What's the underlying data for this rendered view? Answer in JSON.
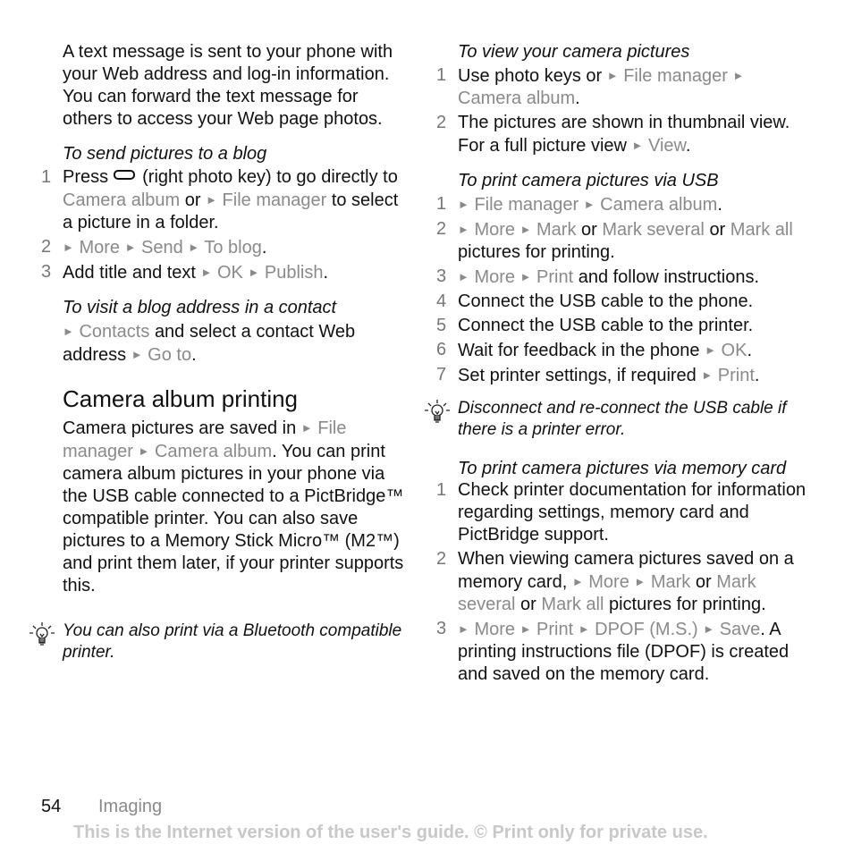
{
  "left": {
    "intro": "A text message is sent to your phone with your Web address and log-in information. You can forward the text message for others to access your Web page photos.",
    "send_blog": {
      "heading": "To send pictures to a blog",
      "s1_a": "Press",
      "s1_b": "(right photo key) to go directly to",
      "s1_g1": "Camera album",
      "s1_c": "or",
      "s1_g2": "File manager",
      "s1_d": "to select a picture in a folder.",
      "s2": [
        "More",
        "Send",
        "To blog"
      ],
      "s3_text": "Add title and text",
      "s3": [
        "OK",
        "Publish"
      ]
    },
    "visit_blog": {
      "heading": "To visit a blog address in a contact",
      "g1": "Contacts",
      "t1": "and select a contact Web address",
      "g2": "Go to"
    },
    "section": {
      "title": "Camera album printing",
      "t1": "Camera pictures are saved in",
      "g1": "File manager",
      "g2": "Camera album",
      "t2": ". You can print camera album pictures in your phone via the USB cable connected to a PictBridge™ compatible printer. You can also save pictures to a Memory Stick Micro™ (M2™) and print them later, if your printer supports this."
    },
    "tip": "You can also print via a Bluetooth compatible printer."
  },
  "right": {
    "view": {
      "heading": "To view your camera pictures",
      "s1_text": "Use photo keys or",
      "s1": [
        "File manager",
        "Camera album"
      ],
      "s2_text": "The pictures are shown in thumbnail view. For a full picture view",
      "s2_g": "View"
    },
    "usb": {
      "heading": "To print camera pictures via USB",
      "s1": [
        "File manager",
        "Camera album"
      ],
      "s2_g1": "More",
      "s2_g2": "Mark",
      "s2_or": "or",
      "s2_g3": "Mark several",
      "s2_g4": "Mark all",
      "s2_t": "pictures for printing.",
      "s3_g1": "More",
      "s3_g2": "Print",
      "s3_t": "and follow instructions.",
      "s4": "Connect the USB cable to the phone.",
      "s5": "Connect the USB cable to the printer.",
      "s6_t": "Wait for feedback in the phone",
      "s6_g": "OK",
      "s7_t": "Set printer settings, if required",
      "s7_g": "Print"
    },
    "tip": "Disconnect and re-connect the USB cable if there is a printer error.",
    "memory": {
      "heading": "To print camera pictures via memory card",
      "s1": "Check printer documentation for information regarding settings, memory card and PictBridge support.",
      "s2_t": "When viewing camera pictures saved on a memory card,",
      "s2_g1": "More",
      "s2_g2": "Mark",
      "s2_or": "or",
      "s2_g3": "Mark several",
      "s2_or2": "or",
      "s2_g4": "Mark all",
      "s2_t2": "pictures for printing.",
      "s3": [
        "More",
        "Print",
        "DPOF (M.S.)",
        "Save"
      ],
      "s3_t": "A printing instructions file (DPOF) is created and saved on the memory card."
    }
  },
  "footer": {
    "page": "54",
    "section": "Imaging",
    "note": "This is the Internet version of the user's guide. © Print only for private use."
  },
  "nums": [
    "1",
    "2",
    "3",
    "4",
    "5",
    "6",
    "7"
  ],
  "arrow": "►"
}
